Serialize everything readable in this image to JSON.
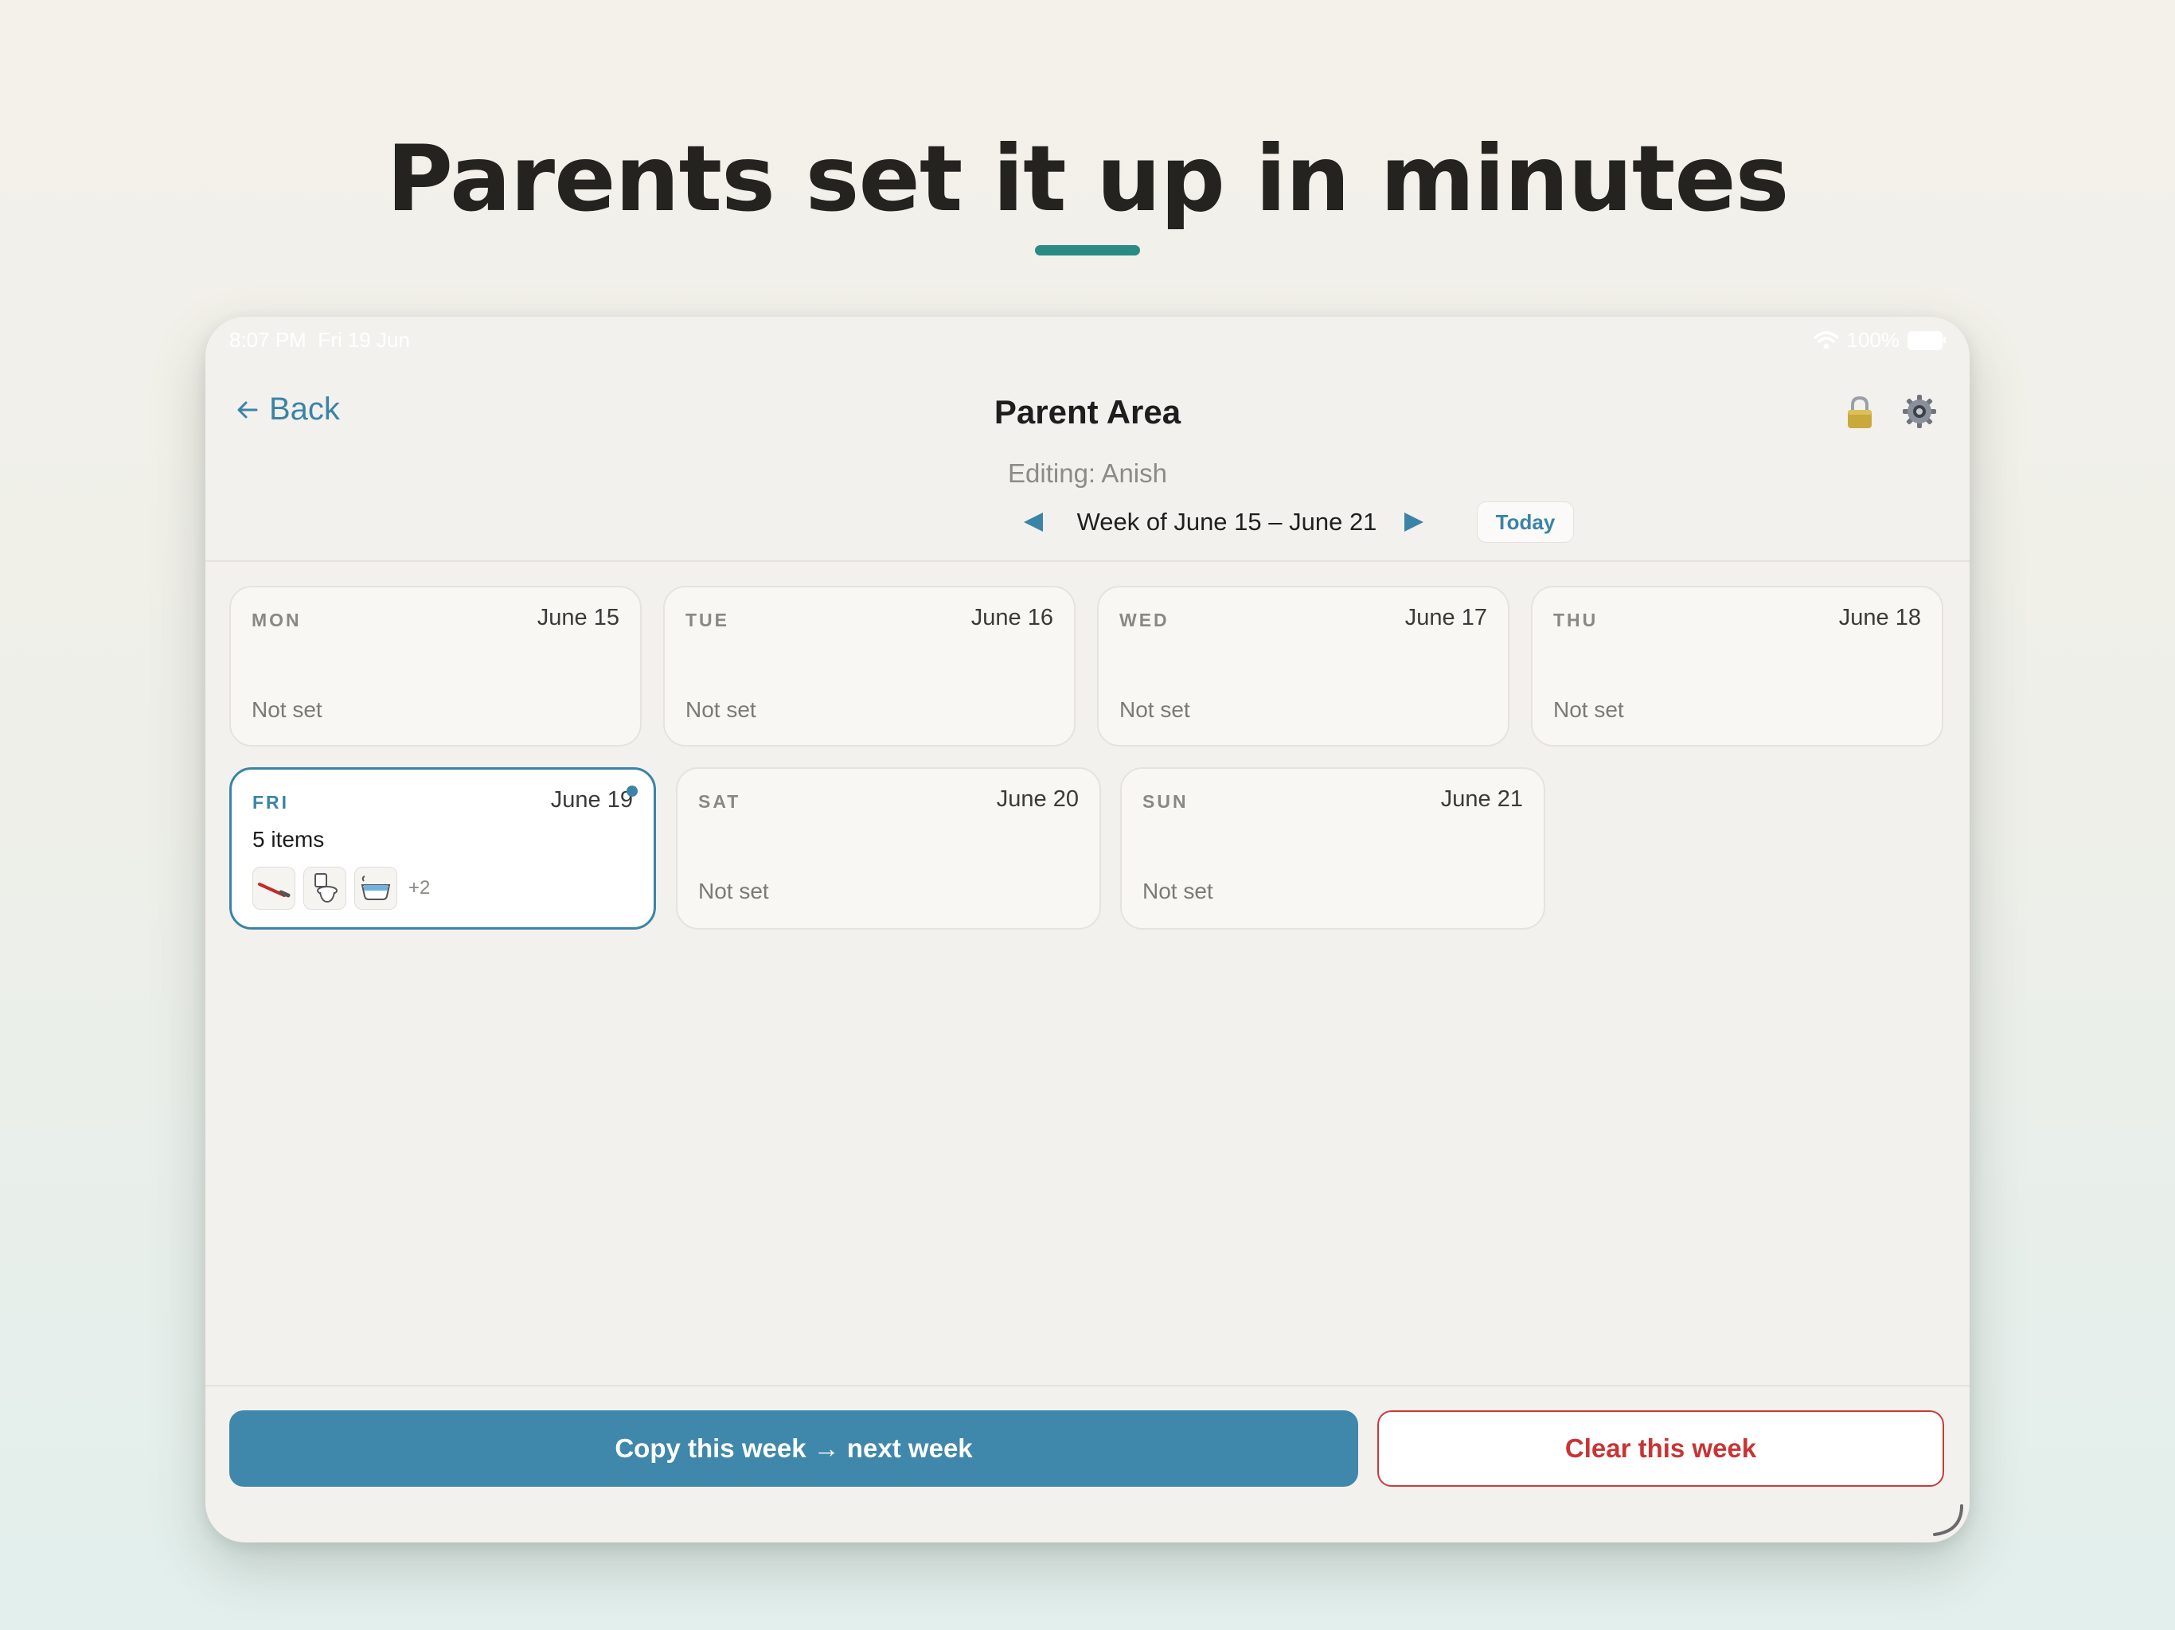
{
  "headline": "Parents set it up in minutes",
  "status_bar": {
    "time": "8:07 PM",
    "date": "Fri 19 Jun",
    "battery": "100%"
  },
  "header": {
    "back_label": "Back",
    "title": "Parent Area",
    "editing": "Editing: Anish"
  },
  "week_nav": {
    "label": "Week of June 15 – June 21",
    "today_label": "Today"
  },
  "days": [
    {
      "abbr": "MON",
      "date": "June 15",
      "status": "Not set"
    },
    {
      "abbr": "TUE",
      "date": "June 16",
      "status": "Not set"
    },
    {
      "abbr": "WED",
      "date": "June 17",
      "status": "Not set"
    },
    {
      "abbr": "THU",
      "date": "June 18",
      "status": "Not set"
    },
    {
      "abbr": "FRI",
      "date": "June 19",
      "count": "5 items",
      "more": "+2",
      "thumbs": [
        "toothbrush-icon",
        "toilet-icon",
        "bath-icon"
      ]
    },
    {
      "abbr": "SAT",
      "date": "June 20",
      "status": "Not set"
    },
    {
      "abbr": "SUN",
      "date": "June 21",
      "status": "Not set"
    }
  ],
  "actions": {
    "copy_label": "Copy this week → next week",
    "clear_label": "Clear this week"
  },
  "colors": {
    "accent": "#3a84a8",
    "primary_button": "#3f88ab",
    "danger": "#c83434",
    "headline_underline": "#2a8a84"
  }
}
